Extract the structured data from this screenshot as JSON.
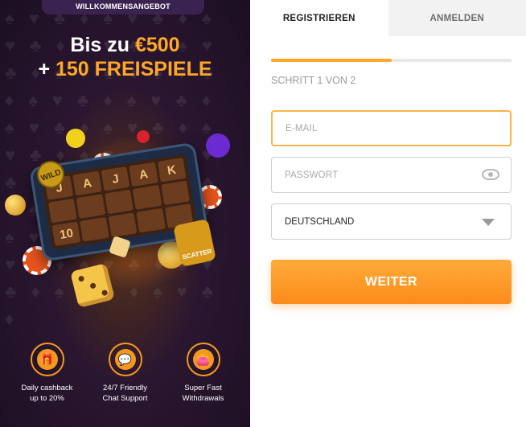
{
  "promo": {
    "badge": "WILLKOMMENSANGEBOT",
    "line1_prefix": "Bis zu ",
    "line1_amount": "€500",
    "line2_prefix": "+ ",
    "line2_spins": "150 FREISPIELE",
    "reels": [
      "J",
      "A",
      "J",
      "A",
      "K",
      "",
      "",
      "",
      "",
      "",
      "10",
      "",
      "",
      "",
      ""
    ],
    "wild_label": "WILD",
    "scatter_label": "SCATTER",
    "features": [
      {
        "icon": "gift-icon",
        "glyph": "🎁",
        "line1": "Daily cashback",
        "line2": "up to 20%"
      },
      {
        "icon": "chat-icon",
        "glyph": "💬",
        "line1": "24/7 Friendly",
        "line2": "Chat Support"
      },
      {
        "icon": "wallet-icon",
        "glyph": "👛",
        "line1": "Super Fast",
        "line2": "Withdrawals"
      }
    ],
    "colors": {
      "accent": "#ffa726",
      "background": "#2a1630",
      "badge": "#3b2351"
    }
  },
  "form": {
    "tabs": [
      {
        "label": "REGISTRIEREN",
        "active": true
      },
      {
        "label": "ANMELDEN",
        "active": false
      }
    ],
    "progress_fraction": 0.5,
    "step_text": "SCHRITT 1 VON 2",
    "email_placeholder": "E-MAIL",
    "password_placeholder": "PASSWORT",
    "country_value": "DEUTSCHLAND",
    "submit_label": "WEITER",
    "colors": {
      "accent": "#ffa726",
      "button": "#fb8c1c"
    }
  }
}
